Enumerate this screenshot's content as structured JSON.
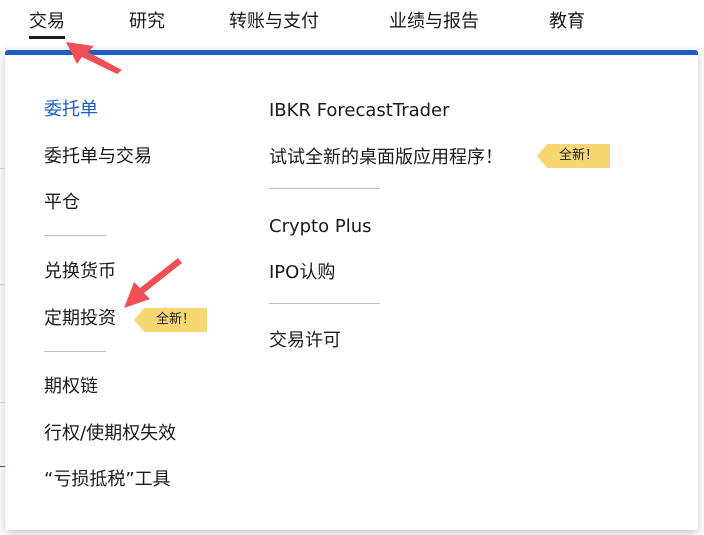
{
  "topnav": {
    "items": [
      {
        "label": "交易"
      },
      {
        "label": "研究"
      },
      {
        "label": "转账与支付"
      },
      {
        "label": "业绩与报告"
      },
      {
        "label": "教育"
      }
    ]
  },
  "dropdown": {
    "left": {
      "items": [
        "委托单",
        "委托单与交易",
        "平仓",
        "兑换货币",
        "定期投资",
        "期权链",
        "行权/使期权失效",
        "“亏损抵税”工具"
      ]
    },
    "right": {
      "items": [
        "IBKR ForecastTrader",
        "试试全新的桌面版应用程序！",
        "Crypto Plus",
        "IPO认购",
        "交易许可"
      ]
    },
    "badge_label": "全新！"
  },
  "colors": {
    "accent": "#1f5dc2",
    "badge": "#f7d774",
    "arrow": "#ef4f55"
  }
}
